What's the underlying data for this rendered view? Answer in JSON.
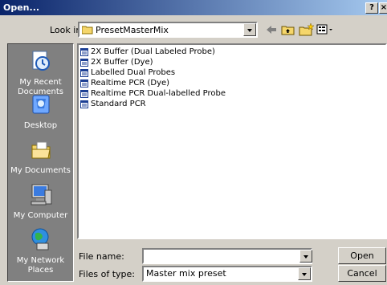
{
  "window": {
    "title": "Open...",
    "help_label": "?",
    "close_label": "×"
  },
  "toolbar": {
    "look_in_label": "Look in:",
    "look_in_value": "PresetMasterMix",
    "back_icon": "back-arrow-icon",
    "up_icon": "up-folder-icon",
    "new_folder_icon": "new-folder-icon",
    "views_icon": "views-menu-icon"
  },
  "places": [
    {
      "label": "My Recent Documents",
      "icon": "recent-documents-icon"
    },
    {
      "label": "Desktop",
      "icon": "desktop-icon"
    },
    {
      "label": "My Documents",
      "icon": "my-documents-icon"
    },
    {
      "label": "My Computer",
      "icon": "my-computer-icon"
    },
    {
      "label": "My Network Places",
      "icon": "network-places-icon"
    }
  ],
  "files": [
    "2X Buffer (Dual Labeled Probe)",
    "2X Buffer (Dye)",
    "Labelled Dual Probes",
    "Realtime PCR (Dye)",
    "Realtime PCR Dual-labelled Probe",
    "Standard PCR"
  ],
  "footer": {
    "file_name_label": "File name:",
    "file_name_value": "",
    "file_type_label": "Files of type:",
    "file_type_value": "Master mix preset",
    "open_label": "Open",
    "cancel_label": "Cancel"
  },
  "colors": {
    "title_start": "#0a246a",
    "title_end": "#a6caf0",
    "face": "#d4d0c8",
    "places_bg": "#808080"
  }
}
